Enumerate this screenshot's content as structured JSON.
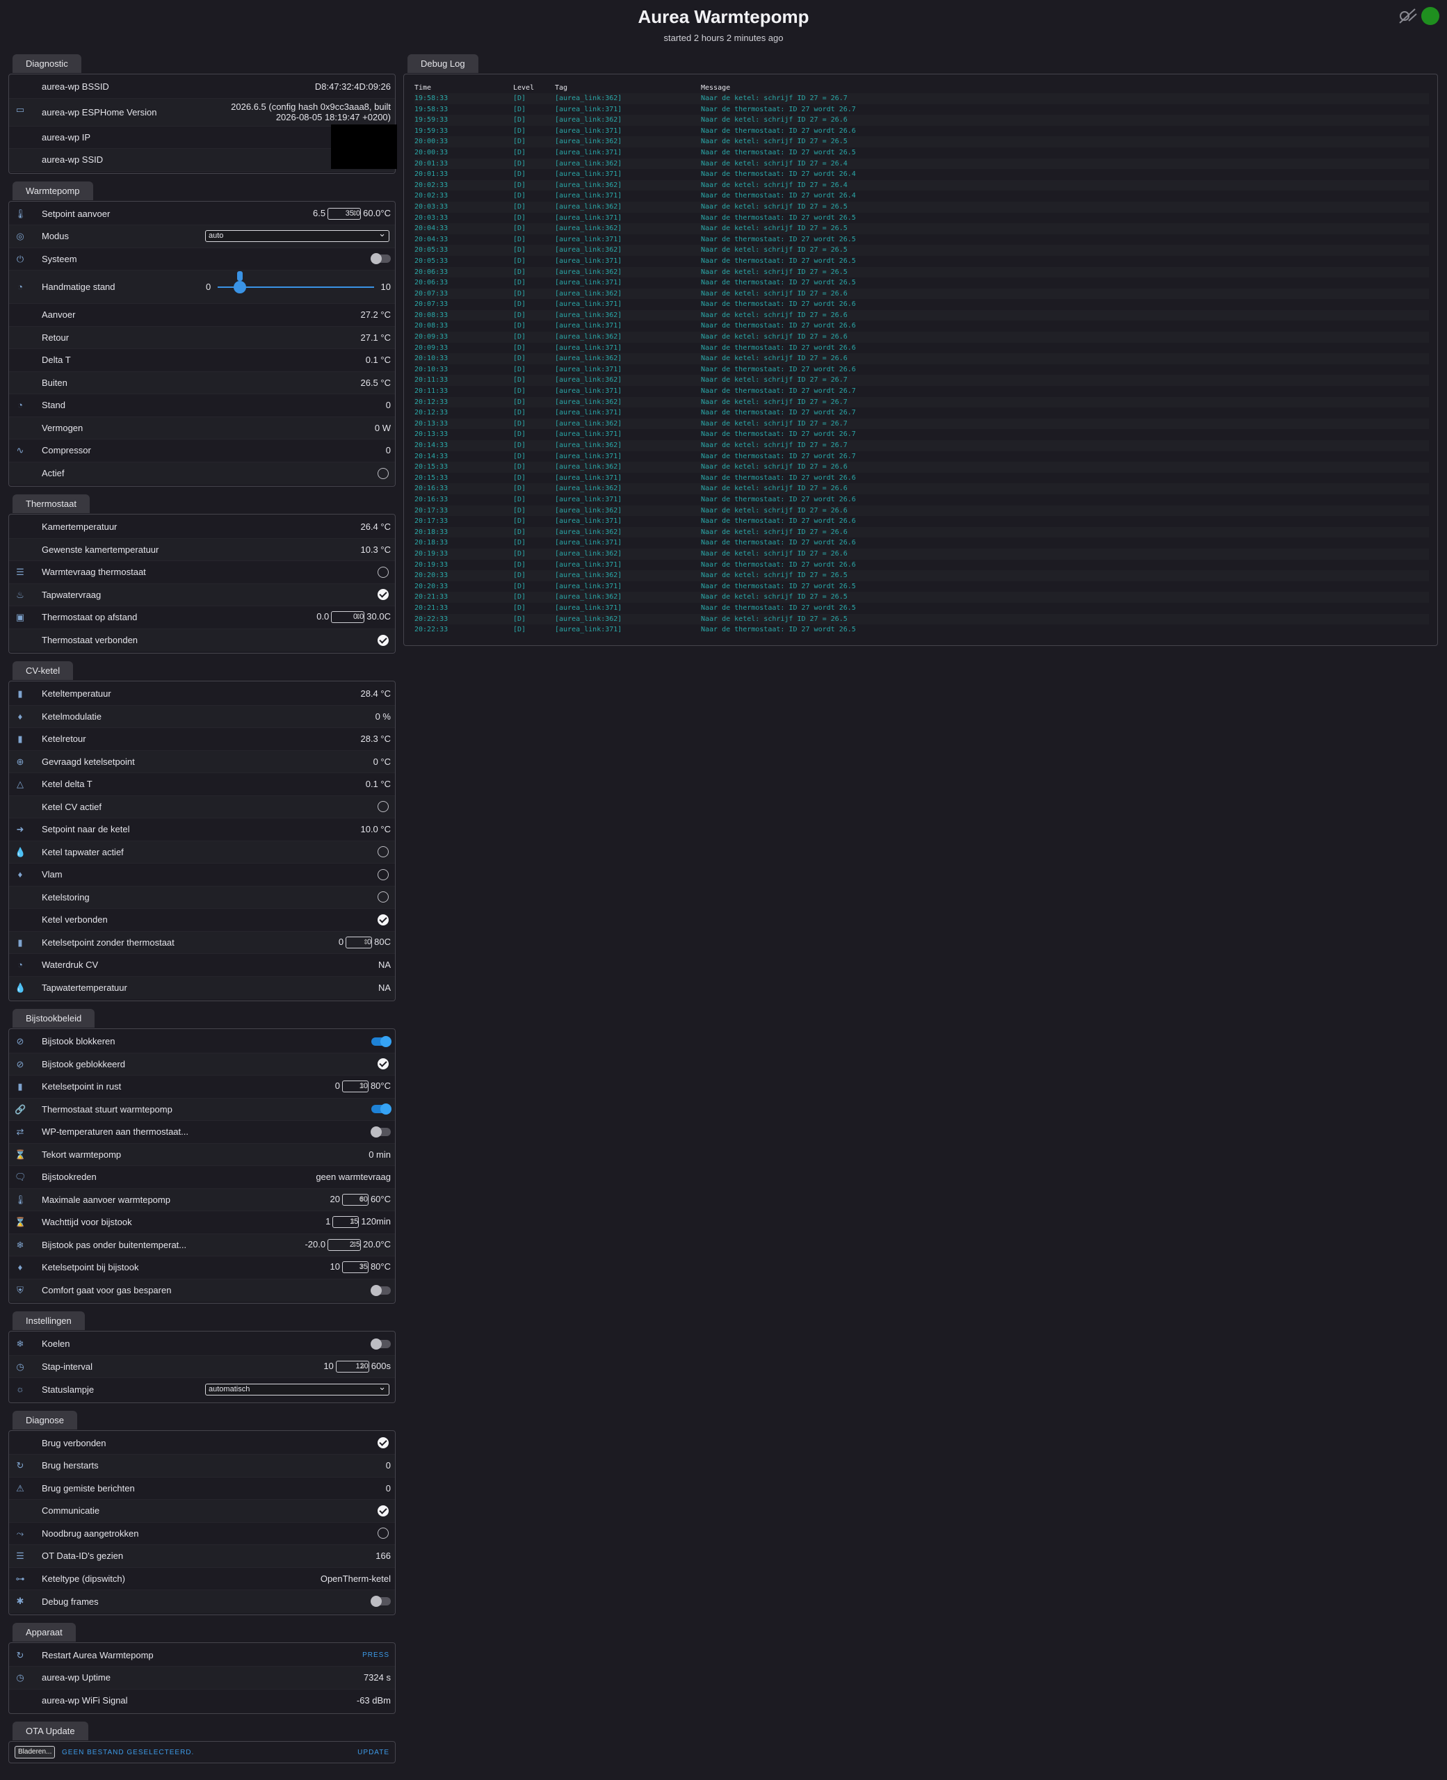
{
  "header": {
    "title": "Aurea Warmtepomp",
    "subtitle": "started 2 hours 2 minutes ago"
  },
  "colors": {
    "accent": "#3a93e5",
    "status_dot": "#1f8f1f",
    "log_text": "#2aa7a7",
    "background": "#1c1b22"
  },
  "diagnostic": {
    "tab": "Diagnostic",
    "bssid_label": "aurea-wp BSSID",
    "bssid": "D8:47:32:4D:09:26",
    "version_label": "aurea-wp ESPHome Version",
    "version": "2026.6.5 (config hash 0x9cc3aaa8, built 2026-08-05 18:19:47 +0200)",
    "ip_label": "aurea-wp IP",
    "ssid_label": "aurea-wp SSID"
  },
  "warmtepomp": {
    "tab": "Warmtepomp",
    "setpoint": {
      "label": "Setpoint aanvoer",
      "min": "6.5",
      "value": "35.0",
      "max": "60.0°C"
    },
    "modus": {
      "label": "Modus",
      "value": "auto"
    },
    "systeem": {
      "label": "Systeem"
    },
    "hand": {
      "label": "Handmatige stand",
      "min": "0",
      "max": "10",
      "value": 1
    },
    "aanvoer": {
      "label": "Aanvoer",
      "value": "27.2 °C"
    },
    "retour": {
      "label": "Retour",
      "value": "27.1 °C"
    },
    "delta": {
      "label": "Delta T",
      "value": "0.1 °C"
    },
    "buiten": {
      "label": "Buiten",
      "value": "26.5 °C"
    },
    "stand": {
      "label": "Stand",
      "value": "0"
    },
    "vermogen": {
      "label": "Vermogen",
      "value": "0 W"
    },
    "compressor": {
      "label": "Compressor",
      "value": "0"
    },
    "actief": {
      "label": "Actief"
    }
  },
  "thermostaat": {
    "tab": "Thermostaat",
    "kamer": {
      "label": "Kamertemperatuur",
      "value": "26.4 °C"
    },
    "gewenst": {
      "label": "Gewenste kamertemperatuur",
      "value": "10.3 °C"
    },
    "warmtevraag": {
      "label": "Warmtevraag thermostaat"
    },
    "tapwater": {
      "label": "Tapwatervraag"
    },
    "afstand": {
      "label": "Thermostaat op afstand",
      "min": "0.0",
      "value": "0.0",
      "max": "30.0C"
    },
    "verbonden": {
      "label": "Thermostaat verbonden"
    }
  },
  "cv": {
    "tab": "CV-ketel",
    "keteltemp": {
      "label": "Keteltemperatuur",
      "value": "28.4 °C"
    },
    "modulatie": {
      "label": "Ketelmodulatie",
      "value": "0 %"
    },
    "retour": {
      "label": "Ketelretour",
      "value": "28.3 °C"
    },
    "gevraagd": {
      "label": "Gevraagd ketelsetpoint",
      "value": "0 °C"
    },
    "delta": {
      "label": "Ketel delta T",
      "value": "0.1 °C"
    },
    "cvactief": {
      "label": "Ketel CV actief"
    },
    "setpoint": {
      "label": "Setpoint naar de ketel",
      "value": "10.0 °C"
    },
    "tapactief": {
      "label": "Ketel tapwater actief"
    },
    "vlam": {
      "label": "Vlam"
    },
    "storing": {
      "label": "Ketelstoring"
    },
    "verbonden": {
      "label": "Ketel verbonden"
    },
    "zonder": {
      "label": "Ketelsetpoint zonder thermostaat",
      "min": "0",
      "value": "0",
      "max": "80C"
    },
    "waterdruk": {
      "label": "Waterdruk CV",
      "value": "NA"
    },
    "taptemp": {
      "label": "Tapwatertemperatuur",
      "value": "NA"
    }
  },
  "bijstook": {
    "tab": "Bijstookbeleid",
    "blokkeren": {
      "label": "Bijstook blokkeren"
    },
    "geblokkeerd": {
      "label": "Bijstook geblokkeerd"
    },
    "rust": {
      "label": "Ketelsetpoint in rust",
      "min": "0",
      "value": "10",
      "max": "80°C"
    },
    "stuurt": {
      "label": "Thermostaat stuurt warmtepomp"
    },
    "wptemp": {
      "label": "WP-temperaturen aan thermostaat..."
    },
    "tekort": {
      "label": "Tekort warmtepomp",
      "value": "0 min"
    },
    "reden": {
      "label": "Bijstookreden",
      "value": "geen warmtevraag"
    },
    "maxaanvoer": {
      "label": "Maximale aanvoer warmtepomp",
      "min": "20",
      "value": "60",
      "max": "60°C"
    },
    "wachttijd": {
      "label": "Wachttijd voor bijstook",
      "min": "1",
      "value": "15",
      "max": "120min"
    },
    "onder": {
      "label": "Bijstook pas onder buitentemperat...",
      "min": "-20.0",
      "value": "2.5",
      "max": "20.0°C"
    },
    "bijstooksp": {
      "label": "Ketelsetpoint bij bijstook",
      "min": "10",
      "value": "35",
      "max": "80°C"
    },
    "comfort": {
      "label": "Comfort gaat voor gas besparen"
    }
  },
  "instellingen": {
    "tab": "Instellingen",
    "koelen": {
      "label": "Koelen"
    },
    "stap": {
      "label": "Stap-interval",
      "min": "10",
      "value": "120",
      "max": "600s"
    },
    "lamp": {
      "label": "Statuslampje",
      "value": "automatisch"
    }
  },
  "diagnose": {
    "tab": "Diagnose",
    "brug": {
      "label": "Brug verbonden"
    },
    "herstarts": {
      "label": "Brug herstarts",
      "value": "0"
    },
    "gemist": {
      "label": "Brug gemiste berichten",
      "value": "0"
    },
    "comm": {
      "label": "Communicatie"
    },
    "nood": {
      "label": "Noodbrug aangetrokken"
    },
    "otid": {
      "label": "OT Data-ID's gezien",
      "value": "166"
    },
    "keteltype": {
      "label": "Keteltype (dipswitch)",
      "value": "OpenTherm-ketel"
    },
    "debug": {
      "label": "Debug frames"
    }
  },
  "apparaat": {
    "tab": "Apparaat",
    "restart": {
      "label": "Restart Aurea Warmtepomp",
      "button": "PRESS"
    },
    "uptime": {
      "label": "aurea-wp Uptime",
      "value": "7324 s"
    },
    "wifi": {
      "label": "aurea-wp WiFi Signal",
      "value": "-63 dBm"
    }
  },
  "ota": {
    "tab": "OTA Update",
    "browse": "Bladeren...",
    "nofile": "GEEN BESTAND GESELECTEERD.",
    "update": "UPDATE"
  },
  "debuglog": {
    "tab": "Debug Log",
    "headers": [
      "Time",
      "Level",
      "Tag",
      "Message"
    ],
    "rows": [
      [
        "19:58:33",
        "[D]",
        "[aurea_link:362]",
        "Naar de ketel: schrijf ID 27 = 26.7"
      ],
      [
        "19:58:33",
        "[D]",
        "[aurea_link:371]",
        "Naar de thermostaat: ID 27 wordt 26.7"
      ],
      [
        "19:59:33",
        "[D]",
        "[aurea_link:362]",
        "Naar de ketel: schrijf ID 27 = 26.6"
      ],
      [
        "19:59:33",
        "[D]",
        "[aurea_link:371]",
        "Naar de thermostaat: ID 27 wordt 26.6"
      ],
      [
        "20:00:33",
        "[D]",
        "[aurea_link:362]",
        "Naar de ketel: schrijf ID 27 = 26.5"
      ],
      [
        "20:00:33",
        "[D]",
        "[aurea_link:371]",
        "Naar de thermostaat: ID 27 wordt 26.5"
      ],
      [
        "20:01:33",
        "[D]",
        "[aurea_link:362]",
        "Naar de ketel: schrijf ID 27 = 26.4"
      ],
      [
        "20:01:33",
        "[D]",
        "[aurea_link:371]",
        "Naar de thermostaat: ID 27 wordt 26.4"
      ],
      [
        "20:02:33",
        "[D]",
        "[aurea_link:362]",
        "Naar de ketel: schrijf ID 27 = 26.4"
      ],
      [
        "20:02:33",
        "[D]",
        "[aurea_link:371]",
        "Naar de thermostaat: ID 27 wordt 26.4"
      ],
      [
        "20:03:33",
        "[D]",
        "[aurea_link:362]",
        "Naar de ketel: schrijf ID 27 = 26.5"
      ],
      [
        "20:03:33",
        "[D]",
        "[aurea_link:371]",
        "Naar de thermostaat: ID 27 wordt 26.5"
      ],
      [
        "20:04:33",
        "[D]",
        "[aurea_link:362]",
        "Naar de ketel: schrijf ID 27 = 26.5"
      ],
      [
        "20:04:33",
        "[D]",
        "[aurea_link:371]",
        "Naar de thermostaat: ID 27 wordt 26.5"
      ],
      [
        "20:05:33",
        "[D]",
        "[aurea_link:362]",
        "Naar de ketel: schrijf ID 27 = 26.5"
      ],
      [
        "20:05:33",
        "[D]",
        "[aurea_link:371]",
        "Naar de thermostaat: ID 27 wordt 26.5"
      ],
      [
        "20:06:33",
        "[D]",
        "[aurea_link:362]",
        "Naar de ketel: schrijf ID 27 = 26.5"
      ],
      [
        "20:06:33",
        "[D]",
        "[aurea_link:371]",
        "Naar de thermostaat: ID 27 wordt 26.5"
      ],
      [
        "20:07:33",
        "[D]",
        "[aurea_link:362]",
        "Naar de ketel: schrijf ID 27 = 26.6"
      ],
      [
        "20:07:33",
        "[D]",
        "[aurea_link:371]",
        "Naar de thermostaat: ID 27 wordt 26.6"
      ],
      [
        "20:08:33",
        "[D]",
        "[aurea_link:362]",
        "Naar de ketel: schrijf ID 27 = 26.6"
      ],
      [
        "20:08:33",
        "[D]",
        "[aurea_link:371]",
        "Naar de thermostaat: ID 27 wordt 26.6"
      ],
      [
        "20:09:33",
        "[D]",
        "[aurea_link:362]",
        "Naar de ketel: schrijf ID 27 = 26.6"
      ],
      [
        "20:09:33",
        "[D]",
        "[aurea_link:371]",
        "Naar de thermostaat: ID 27 wordt 26.6"
      ],
      [
        "20:10:33",
        "[D]",
        "[aurea_link:362]",
        "Naar de ketel: schrijf ID 27 = 26.6"
      ],
      [
        "20:10:33",
        "[D]",
        "[aurea_link:371]",
        "Naar de thermostaat: ID 27 wordt 26.6"
      ],
      [
        "20:11:33",
        "[D]",
        "[aurea_link:362]",
        "Naar de ketel: schrijf ID 27 = 26.7"
      ],
      [
        "20:11:33",
        "[D]",
        "[aurea_link:371]",
        "Naar de thermostaat: ID 27 wordt 26.7"
      ],
      [
        "20:12:33",
        "[D]",
        "[aurea_link:362]",
        "Naar de ketel: schrijf ID 27 = 26.7"
      ],
      [
        "20:12:33",
        "[D]",
        "[aurea_link:371]",
        "Naar de thermostaat: ID 27 wordt 26.7"
      ],
      [
        "20:13:33",
        "[D]",
        "[aurea_link:362]",
        "Naar de ketel: schrijf ID 27 = 26.7"
      ],
      [
        "20:13:33",
        "[D]",
        "[aurea_link:371]",
        "Naar de thermostaat: ID 27 wordt 26.7"
      ],
      [
        "20:14:33",
        "[D]",
        "[aurea_link:362]",
        "Naar de ketel: schrijf ID 27 = 26.7"
      ],
      [
        "20:14:33",
        "[D]",
        "[aurea_link:371]",
        "Naar de thermostaat: ID 27 wordt 26.7"
      ],
      [
        "20:15:33",
        "[D]",
        "[aurea_link:362]",
        "Naar de ketel: schrijf ID 27 = 26.6"
      ],
      [
        "20:15:33",
        "[D]",
        "[aurea_link:371]",
        "Naar de thermostaat: ID 27 wordt 26.6"
      ],
      [
        "20:16:33",
        "[D]",
        "[aurea_link:362]",
        "Naar de ketel: schrijf ID 27 = 26.6"
      ],
      [
        "20:16:33",
        "[D]",
        "[aurea_link:371]",
        "Naar de thermostaat: ID 27 wordt 26.6"
      ],
      [
        "20:17:33",
        "[D]",
        "[aurea_link:362]",
        "Naar de ketel: schrijf ID 27 = 26.6"
      ],
      [
        "20:17:33",
        "[D]",
        "[aurea_link:371]",
        "Naar de thermostaat: ID 27 wordt 26.6"
      ],
      [
        "20:18:33",
        "[D]",
        "[aurea_link:362]",
        "Naar de ketel: schrijf ID 27 = 26.6"
      ],
      [
        "20:18:33",
        "[D]",
        "[aurea_link:371]",
        "Naar de thermostaat: ID 27 wordt 26.6"
      ],
      [
        "20:19:33",
        "[D]",
        "[aurea_link:362]",
        "Naar de ketel: schrijf ID 27 = 26.6"
      ],
      [
        "20:19:33",
        "[D]",
        "[aurea_link:371]",
        "Naar de thermostaat: ID 27 wordt 26.6"
      ],
      [
        "20:20:33",
        "[D]",
        "[aurea_link:362]",
        "Naar de ketel: schrijf ID 27 = 26.5"
      ],
      [
        "20:20:33",
        "[D]",
        "[aurea_link:371]",
        "Naar de thermostaat: ID 27 wordt 26.5"
      ],
      [
        "20:21:33",
        "[D]",
        "[aurea_link:362]",
        "Naar de ketel: schrijf ID 27 = 26.5"
      ],
      [
        "20:21:33",
        "[D]",
        "[aurea_link:371]",
        "Naar de thermostaat: ID 27 wordt 26.5"
      ],
      [
        "20:22:33",
        "[D]",
        "[aurea_link:362]",
        "Naar de ketel: schrijf ID 27 = 26.5"
      ],
      [
        "20:22:33",
        "[D]",
        "[aurea_link:371]",
        "Naar de thermostaat: ID 27 wordt 26.5"
      ]
    ]
  }
}
